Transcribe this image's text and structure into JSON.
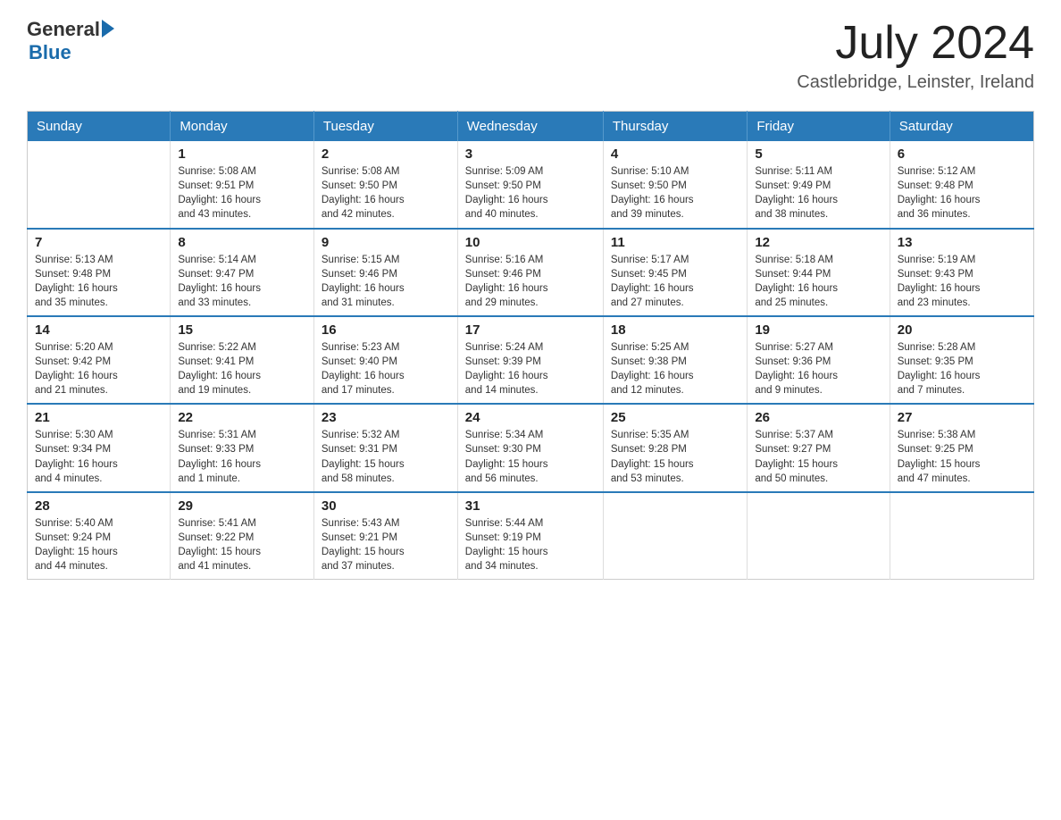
{
  "header": {
    "logo_general": "General",
    "logo_blue": "Blue",
    "month_title": "July 2024",
    "location": "Castlebridge, Leinster, Ireland"
  },
  "weekdays": [
    "Sunday",
    "Monday",
    "Tuesday",
    "Wednesday",
    "Thursday",
    "Friday",
    "Saturday"
  ],
  "weeks": [
    [
      {
        "day": "",
        "info": ""
      },
      {
        "day": "1",
        "info": "Sunrise: 5:08 AM\nSunset: 9:51 PM\nDaylight: 16 hours\nand 43 minutes."
      },
      {
        "day": "2",
        "info": "Sunrise: 5:08 AM\nSunset: 9:50 PM\nDaylight: 16 hours\nand 42 minutes."
      },
      {
        "day": "3",
        "info": "Sunrise: 5:09 AM\nSunset: 9:50 PM\nDaylight: 16 hours\nand 40 minutes."
      },
      {
        "day": "4",
        "info": "Sunrise: 5:10 AM\nSunset: 9:50 PM\nDaylight: 16 hours\nand 39 minutes."
      },
      {
        "day": "5",
        "info": "Sunrise: 5:11 AM\nSunset: 9:49 PM\nDaylight: 16 hours\nand 38 minutes."
      },
      {
        "day": "6",
        "info": "Sunrise: 5:12 AM\nSunset: 9:48 PM\nDaylight: 16 hours\nand 36 minutes."
      }
    ],
    [
      {
        "day": "7",
        "info": "Sunrise: 5:13 AM\nSunset: 9:48 PM\nDaylight: 16 hours\nand 35 minutes."
      },
      {
        "day": "8",
        "info": "Sunrise: 5:14 AM\nSunset: 9:47 PM\nDaylight: 16 hours\nand 33 minutes."
      },
      {
        "day": "9",
        "info": "Sunrise: 5:15 AM\nSunset: 9:46 PM\nDaylight: 16 hours\nand 31 minutes."
      },
      {
        "day": "10",
        "info": "Sunrise: 5:16 AM\nSunset: 9:46 PM\nDaylight: 16 hours\nand 29 minutes."
      },
      {
        "day": "11",
        "info": "Sunrise: 5:17 AM\nSunset: 9:45 PM\nDaylight: 16 hours\nand 27 minutes."
      },
      {
        "day": "12",
        "info": "Sunrise: 5:18 AM\nSunset: 9:44 PM\nDaylight: 16 hours\nand 25 minutes."
      },
      {
        "day": "13",
        "info": "Sunrise: 5:19 AM\nSunset: 9:43 PM\nDaylight: 16 hours\nand 23 minutes."
      }
    ],
    [
      {
        "day": "14",
        "info": "Sunrise: 5:20 AM\nSunset: 9:42 PM\nDaylight: 16 hours\nand 21 minutes."
      },
      {
        "day": "15",
        "info": "Sunrise: 5:22 AM\nSunset: 9:41 PM\nDaylight: 16 hours\nand 19 minutes."
      },
      {
        "day": "16",
        "info": "Sunrise: 5:23 AM\nSunset: 9:40 PM\nDaylight: 16 hours\nand 17 minutes."
      },
      {
        "day": "17",
        "info": "Sunrise: 5:24 AM\nSunset: 9:39 PM\nDaylight: 16 hours\nand 14 minutes."
      },
      {
        "day": "18",
        "info": "Sunrise: 5:25 AM\nSunset: 9:38 PM\nDaylight: 16 hours\nand 12 minutes."
      },
      {
        "day": "19",
        "info": "Sunrise: 5:27 AM\nSunset: 9:36 PM\nDaylight: 16 hours\nand 9 minutes."
      },
      {
        "day": "20",
        "info": "Sunrise: 5:28 AM\nSunset: 9:35 PM\nDaylight: 16 hours\nand 7 minutes."
      }
    ],
    [
      {
        "day": "21",
        "info": "Sunrise: 5:30 AM\nSunset: 9:34 PM\nDaylight: 16 hours\nand 4 minutes."
      },
      {
        "day": "22",
        "info": "Sunrise: 5:31 AM\nSunset: 9:33 PM\nDaylight: 16 hours\nand 1 minute."
      },
      {
        "day": "23",
        "info": "Sunrise: 5:32 AM\nSunset: 9:31 PM\nDaylight: 15 hours\nand 58 minutes."
      },
      {
        "day": "24",
        "info": "Sunrise: 5:34 AM\nSunset: 9:30 PM\nDaylight: 15 hours\nand 56 minutes."
      },
      {
        "day": "25",
        "info": "Sunrise: 5:35 AM\nSunset: 9:28 PM\nDaylight: 15 hours\nand 53 minutes."
      },
      {
        "day": "26",
        "info": "Sunrise: 5:37 AM\nSunset: 9:27 PM\nDaylight: 15 hours\nand 50 minutes."
      },
      {
        "day": "27",
        "info": "Sunrise: 5:38 AM\nSunset: 9:25 PM\nDaylight: 15 hours\nand 47 minutes."
      }
    ],
    [
      {
        "day": "28",
        "info": "Sunrise: 5:40 AM\nSunset: 9:24 PM\nDaylight: 15 hours\nand 44 minutes."
      },
      {
        "day": "29",
        "info": "Sunrise: 5:41 AM\nSunset: 9:22 PM\nDaylight: 15 hours\nand 41 minutes."
      },
      {
        "day": "30",
        "info": "Sunrise: 5:43 AM\nSunset: 9:21 PM\nDaylight: 15 hours\nand 37 minutes."
      },
      {
        "day": "31",
        "info": "Sunrise: 5:44 AM\nSunset: 9:19 PM\nDaylight: 15 hours\nand 34 minutes."
      },
      {
        "day": "",
        "info": ""
      },
      {
        "day": "",
        "info": ""
      },
      {
        "day": "",
        "info": ""
      }
    ]
  ]
}
